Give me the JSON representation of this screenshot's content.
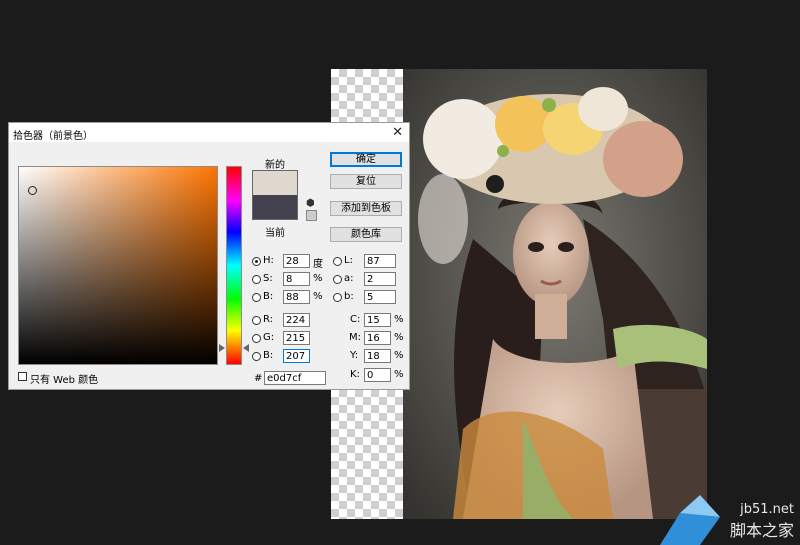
{
  "dialog": {
    "title": "拾色器（前景色）",
    "close_glyph": "✕",
    "new_label": "新的",
    "current_label": "当前",
    "new_color": "#e0d7cf",
    "current_color": "#43414d",
    "buttons": {
      "ok": "确定",
      "reset": "复位",
      "add_swatch": "添加到色板",
      "libraries": "颜色库"
    },
    "fields": {
      "H": {
        "label": "H:",
        "value": "28",
        "unit": "度"
      },
      "S": {
        "label": "S:",
        "value": "8",
        "unit": "%"
      },
      "B": {
        "label": "B:",
        "value": "88",
        "unit": "%"
      },
      "R": {
        "label": "R:",
        "value": "224"
      },
      "G": {
        "label": "G:",
        "value": "215"
      },
      "Bl": {
        "label": "B:",
        "value": "207"
      },
      "L": {
        "label": "L:",
        "value": "87"
      },
      "a": {
        "label": "a:",
        "value": "2"
      },
      "b": {
        "label": "b:",
        "value": "5"
      },
      "C": {
        "label": "C:",
        "value": "15",
        "unit": "%"
      },
      "M": {
        "label": "M:",
        "value": "16",
        "unit": "%"
      },
      "Y": {
        "label": "Y:",
        "value": "18",
        "unit": "%"
      },
      "K": {
        "label": "K:",
        "value": "0",
        "unit": "%"
      },
      "hex": {
        "label": "#",
        "value": "e0d7cf"
      }
    },
    "web_only_label": "只有 Web 颜色",
    "selected_mode": "H",
    "field_hue_color": "#ff7400"
  },
  "watermark": {
    "url": "jb51.net",
    "name": "脚本之家"
  },
  "icons": {
    "gamut_cube": "cube-icon",
    "websafe": "websafe-swatch-icon"
  }
}
